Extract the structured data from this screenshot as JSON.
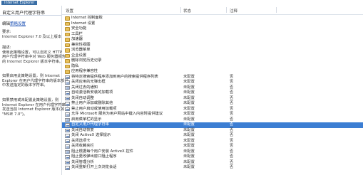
{
  "breadcrumb": "Internet Explorer",
  "left_pane": {
    "title": "自定义用户代理字符串",
    "edit_prefix": "编辑",
    "edit_link": "策略设置",
    "requirements": [
      "要求:",
      "Internet Explorer 7.0 及以上版本"
    ],
    "description": [
      "描述:",
      "使用此策略设置，可以自定义 HTTP",
      "用户代理字符串中对 Web 服务器报告",
      "的 Internet Explorer 版本字符串。"
    ],
    "enabled_text": [
      "如果启用此策略设置，则 Internet",
      "Explorer 在用户代理字符串的版本部分",
      "中发送指定的版本字符串。"
    ],
    "disabled_text": [
      "如果禁用或未配置此策略设置，则",
      "Internet Explorer 在用户代理字符串中",
      "发送当前 Internet Explorer 版本(如",
      "\"MSIE 7.0\")。"
    ]
  },
  "columns": {
    "setting": "设置",
    "state": "状态",
    "note": "注释"
  },
  "rows": [
    {
      "type": "folder",
      "name": "Internet 控制面板",
      "state": "",
      "note": ""
    },
    {
      "type": "folder",
      "name": "Internet 设置",
      "state": "",
      "note": ""
    },
    {
      "type": "folder",
      "name": "安全功能",
      "state": "",
      "note": ""
    },
    {
      "type": "folder",
      "name": "工具栏",
      "state": "",
      "note": ""
    },
    {
      "type": "folder",
      "name": "加速器",
      "state": "",
      "note": ""
    },
    {
      "type": "folder",
      "name": "兼容性视图",
      "state": "",
      "note": ""
    },
    {
      "type": "folder",
      "name": "浏览器菜单",
      "state": "",
      "note": ""
    },
    {
      "type": "folder",
      "name": "企业设置",
      "state": "",
      "note": ""
    },
    {
      "type": "folder",
      "name": "删除浏览历史记录",
      "state": "",
      "note": ""
    },
    {
      "type": "folder",
      "name": "隐私",
      "state": "",
      "note": ""
    },
    {
      "type": "folder",
      "name": "应用程序兼容性",
      "state": "",
      "note": ""
    },
    {
      "type": "setting",
      "name": "将特定搜索提供程序添加到用户的搜索提供程序列表",
      "state": "未配置",
      "note": "否"
    },
    {
      "type": "setting",
      "name": "关闭应用的无弹出框",
      "state": "未配置",
      "note": "否"
    },
    {
      "type": "setting",
      "name": "关闭过去的通知",
      "state": "未配置",
      "note": "否"
    },
    {
      "type": "setting",
      "name": "自动激活新安装的加载项",
      "state": "未配置",
      "note": "否"
    },
    {
      "type": "setting",
      "name": "关闭自动调整",
      "state": "未配置",
      "note": "否"
    },
    {
      "type": "setting",
      "name": "禁止用户添加或删除其他",
      "state": "未配置",
      "note": "否"
    },
    {
      "type": "setting",
      "name": "禁止用户启动或使用加载项",
      "state": "未配置",
      "note": "否"
    },
    {
      "type": "setting",
      "name": "允许 Microsoft 服务为用户网站中键入内容时提供建议",
      "state": "未配置",
      "note": "否"
    },
    {
      "type": "setting",
      "name": "启用菜单栏的显示",
      "state": "未配置",
      "note": "否"
    },
    {
      "type": "setting",
      "name": "自定义用户代理字符串",
      "state": "未配置",
      "note": "否",
      "selected": true
    },
    {
      "type": "setting",
      "name": "关闭自动恢复",
      "state": "未配置",
      "note": "否"
    },
    {
      "type": "setting",
      "name": "关闭 ActiveX 选择提示",
      "state": "未配置",
      "note": "否"
    },
    {
      "type": "setting",
      "name": "关闭选项卡",
      "state": "未配置",
      "note": "否"
    },
    {
      "type": "setting",
      "name": "关闭收藏夹栏",
      "state": "未配置",
      "note": "否"
    },
    {
      "type": "setting",
      "name": "阻止根据每个用户安装 ActiveX 控件",
      "state": "未配置",
      "note": "否"
    },
    {
      "type": "setting",
      "name": "阻止更改弹出窗口阻止程序",
      "state": "未配置",
      "note": "否"
    },
    {
      "type": "setting",
      "name": "关闭管理分析",
      "state": "未配置",
      "note": "否"
    },
    {
      "type": "setting",
      "name": "关闭重新打开上次浏览会话",
      "state": "未配置",
      "note": "否"
    }
  ]
}
